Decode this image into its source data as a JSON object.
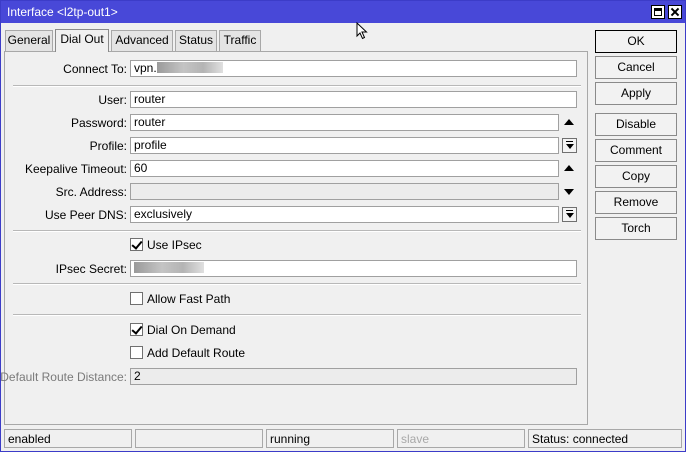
{
  "window": {
    "title": "Interface <l2tp-out1>"
  },
  "tabs": [
    {
      "label": "General"
    },
    {
      "label": "Dial Out"
    },
    {
      "label": "Advanced"
    },
    {
      "label": "Status"
    },
    {
      "label": "Traffic"
    }
  ],
  "active_tab": "Dial Out",
  "form": {
    "connect_to": {
      "label": "Connect To:",
      "value": "vpn."
    },
    "user": {
      "label": "User:",
      "value": "router"
    },
    "password": {
      "label": "Password:",
      "value": "router"
    },
    "profile": {
      "label": "Profile:",
      "value": "profile"
    },
    "keepalive": {
      "label": "Keepalive Timeout:",
      "value": "60"
    },
    "src_address": {
      "label": "Src. Address:",
      "value": ""
    },
    "use_peer_dns": {
      "label": "Use Peer DNS:",
      "value": "exclusively"
    },
    "use_ipsec": {
      "label": "Use IPsec",
      "checked": true
    },
    "ipsec_secret": {
      "label": "IPsec Secret:",
      "value": ""
    },
    "allow_fast_path": {
      "label": "Allow Fast Path",
      "checked": false
    },
    "dial_on_demand": {
      "label": "Dial On Demand",
      "checked": true
    },
    "add_default_route": {
      "label": "Add Default Route",
      "checked": false
    },
    "default_route_distance": {
      "label": "Default Route Distance:",
      "value": "2"
    }
  },
  "buttons": {
    "ok": "OK",
    "cancel": "Cancel",
    "apply": "Apply",
    "disable": "Disable",
    "comment": "Comment",
    "copy": "Copy",
    "remove": "Remove",
    "torch": "Torch"
  },
  "status": {
    "state": "enabled",
    "cell2": "",
    "running": "running",
    "slave": "slave",
    "connection": "Status: connected"
  },
  "colors": {
    "titlebar": "#4848d8",
    "background": "#f0f0f0"
  }
}
